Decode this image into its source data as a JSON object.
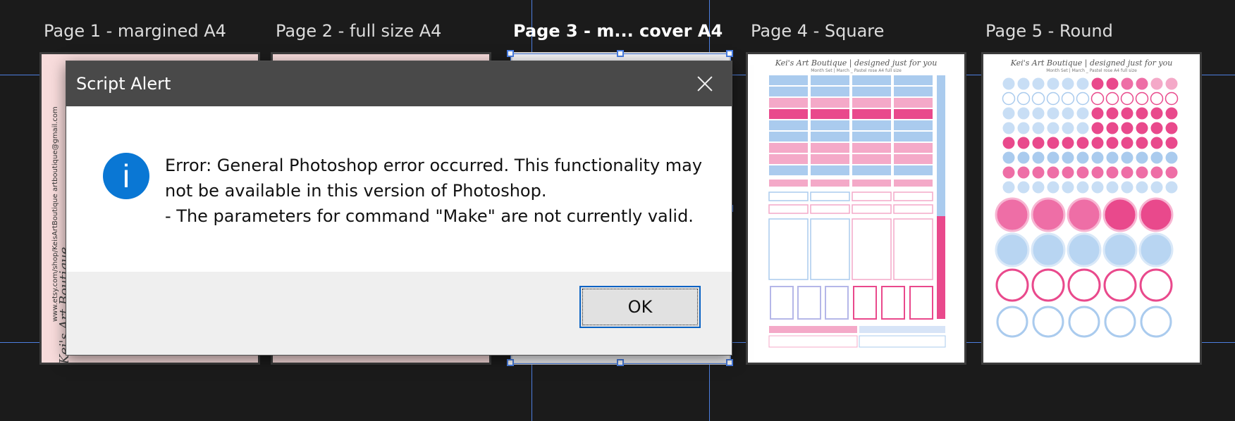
{
  "artboards": [
    {
      "title": "Page 1 - margined A4"
    },
    {
      "title": "Page 2 - full size A4"
    },
    {
      "title": "Page 3 - m... cover A4"
    },
    {
      "title": "Page 4 - Square"
    },
    {
      "title": "Page 5 - Round"
    }
  ],
  "page1": {
    "contact_text": "www.etsy.com/shop/KeisArtBoutique   artboutique@gmail.com",
    "signature": "Kei's Art Boutique"
  },
  "page4": {
    "header": "Kei's Art Boutique  |  designed just for you",
    "sub": "Month Set | March _ Pastel rose    A4 full size"
  },
  "page5": {
    "header": "Kei's Art Boutique  |  designed just for you",
    "sub": "Month Set | March _ Pastel rose    A4 full size"
  },
  "dialog": {
    "title": "Script Alert",
    "message_lines": [
      "Error: General Photoshop error occurred. This functionality may",
      "not be available in this version of Photoshop.",
      "- The parameters for command \"Make\" are not currently valid."
    ],
    "ok_label": "OK",
    "info_glyph": "i"
  },
  "colors": {
    "canvas": "#1b1b1b",
    "guides": "#4d7fe0",
    "titlebar": "#494949",
    "info_blue": "#0a77d4",
    "pink_light": "#f4a9c8",
    "pink_dark": "#e9498c",
    "blue_light": "#aacbee"
  }
}
